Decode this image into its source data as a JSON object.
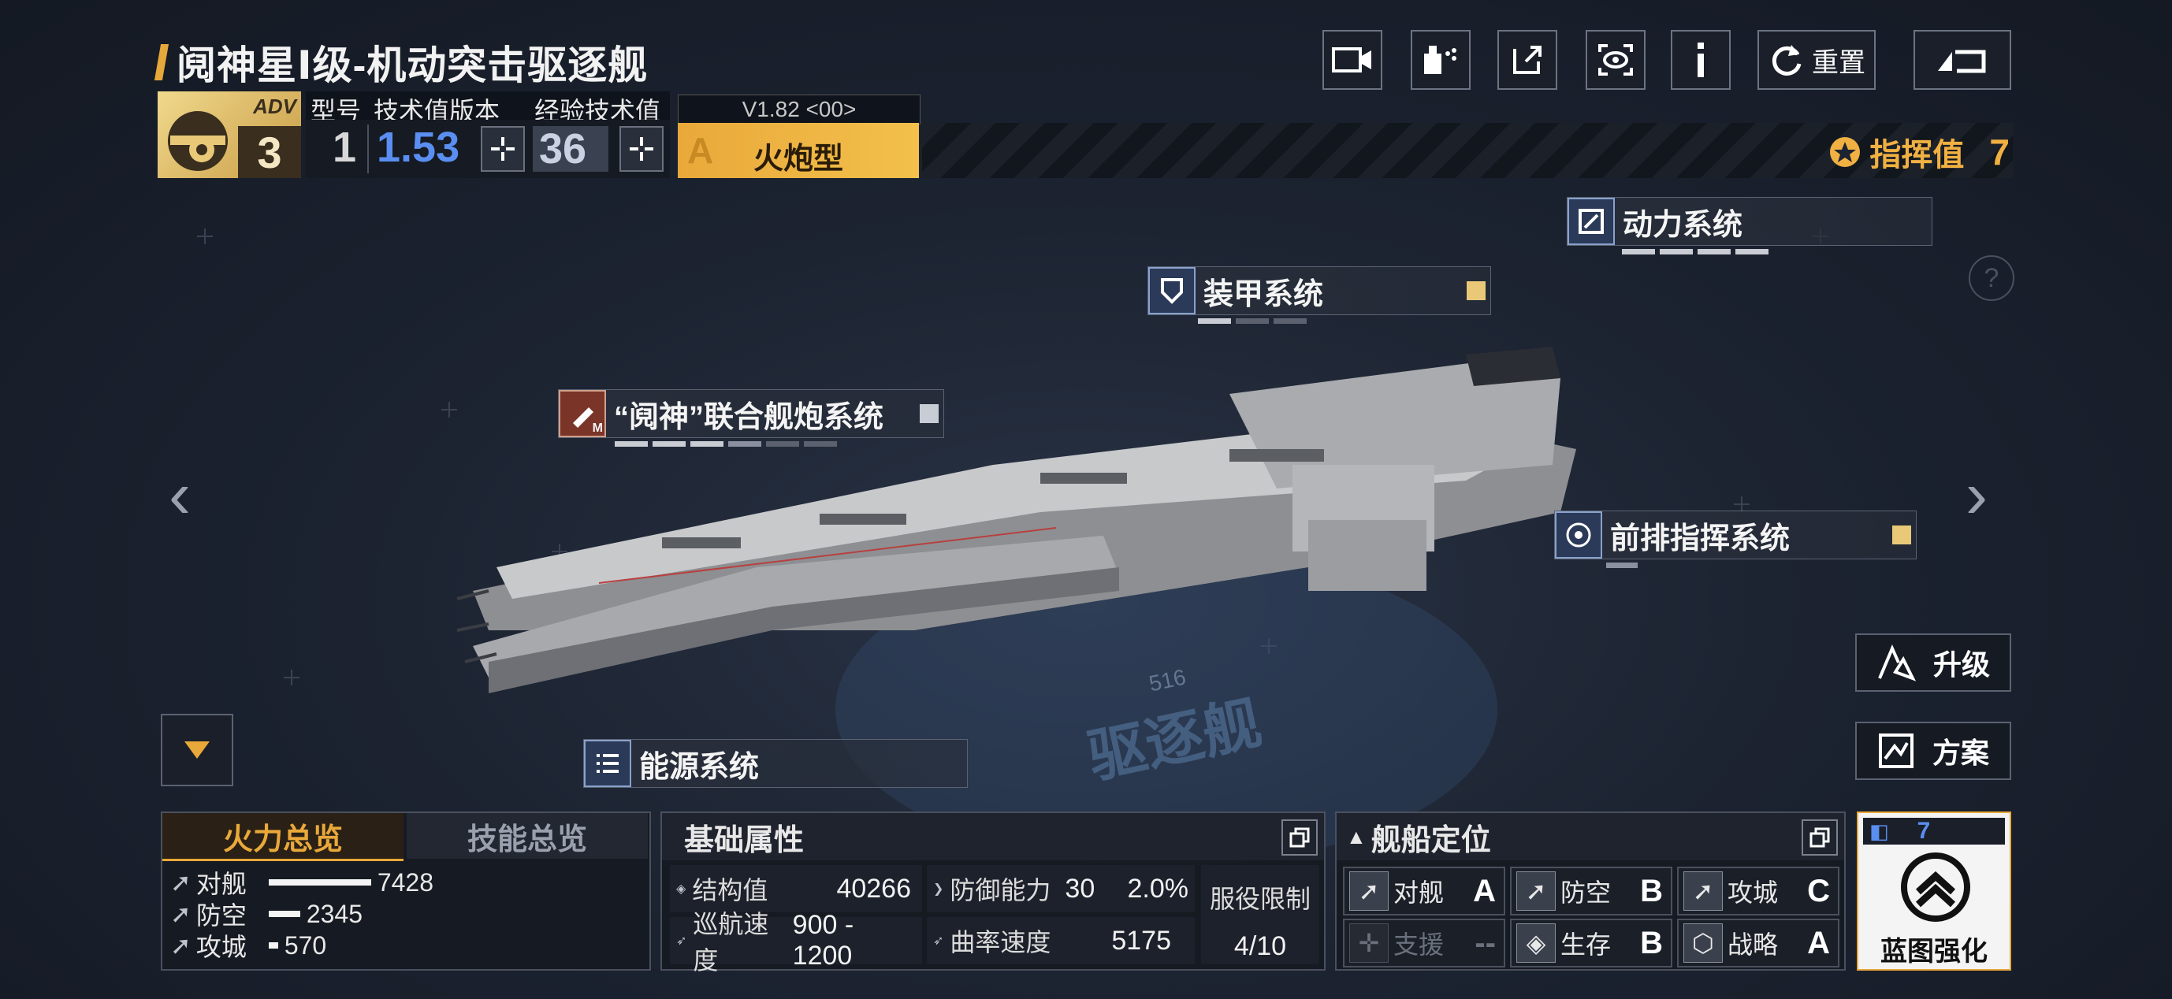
{
  "header": {
    "title": "阋神星Ⅰ级-机动突击驱逐舰",
    "reset_label": "重置"
  },
  "ship_stats": {
    "adv_tag": "ADV",
    "adv_level": "3",
    "model_label": "型号",
    "tech_version_label": "技术值版本",
    "exp_tech_label": "经验技术值",
    "model_value": "1",
    "tech_version_value": "1.53",
    "exp_tech_value": "36"
  },
  "variant": {
    "version": "V1.82 <00>",
    "grade_letter": "A",
    "type": "火炮型"
  },
  "command": {
    "label": "指挥值",
    "value": "7"
  },
  "systems": {
    "power": "动力系统",
    "armor": "装甲系统",
    "cannon": "“阋神”联合舰炮系统",
    "cannon_badge": "M",
    "forward": "前排指挥系统",
    "energy": "能源系统"
  },
  "watermark": {
    "class_text": "驱逐舰",
    "hull_number": "516"
  },
  "side_buttons": {
    "upgrade": "升级",
    "plan": "方案"
  },
  "firepower_panel": {
    "tab_fire": "火力总览",
    "tab_skill": "技能总览",
    "rows": [
      {
        "label": "对舰",
        "value": "7428",
        "ratio": 1.0
      },
      {
        "label": "防空",
        "value": "2345",
        "ratio": 0.32
      },
      {
        "label": "攻城",
        "value": "570",
        "ratio": 0.08
      }
    ]
  },
  "basic_attrs": {
    "title": "基础属性",
    "structure_label": "结构值",
    "structure_value": "40266",
    "defense_label": "防御能力",
    "defense_value": "30",
    "defense_pct": "2.0%",
    "cruise_label": "巡航速度",
    "cruise_value": "900 - 1200",
    "curve_label": "曲率速度",
    "curve_value": "5175",
    "service_label": "服役限制",
    "service_value": "4/10"
  },
  "positioning": {
    "title": "舰船定位",
    "roles": [
      {
        "label": "对舰",
        "grade": "A",
        "icon": "anti-ship-icon"
      },
      {
        "label": "防空",
        "grade": "B",
        "icon": "anti-air-icon"
      },
      {
        "label": "攻城",
        "grade": "C",
        "icon": "siege-icon"
      },
      {
        "label": "支援",
        "grade": "--",
        "icon": "support-icon"
      },
      {
        "label": "生存",
        "grade": "B",
        "icon": "survival-icon"
      },
      {
        "label": "战略",
        "grade": "A",
        "icon": "strategy-icon"
      }
    ]
  },
  "blueprint": {
    "count": "7",
    "label": "蓝图强化"
  },
  "colors": {
    "accent_gold": "#e9a93a",
    "tech_blue": "#5a8ef0",
    "background": "#1c2331"
  }
}
